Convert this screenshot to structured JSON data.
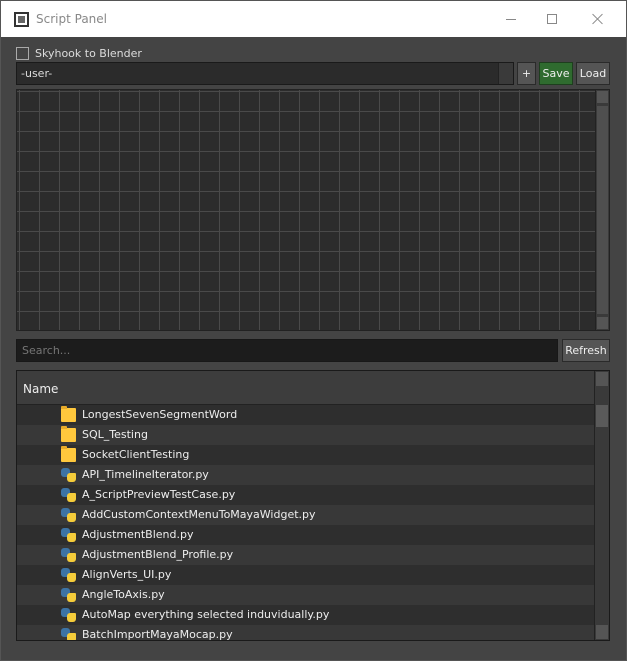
{
  "window": {
    "title": "Script Panel"
  },
  "options": {
    "skyhook_label": "Skyhook to Blender",
    "skyhook_checked": false
  },
  "toolbar": {
    "profile_value": "-user-",
    "plus_label": "+",
    "save_label": "Save",
    "load_label": "Load",
    "save_color": "#2f6b2f"
  },
  "search": {
    "placeholder": "Search...",
    "value": ""
  },
  "refresh_label": "Refresh",
  "tree": {
    "column_header": "Name",
    "items": [
      {
        "type": "folder",
        "icon": "folder-icon",
        "label": "LongestSevenSegmentWord"
      },
      {
        "type": "folder",
        "icon": "folder-icon",
        "label": "SQL_Testing"
      },
      {
        "type": "folder",
        "icon": "folder-icon",
        "label": "SocketClientTesting"
      },
      {
        "type": "file",
        "icon": "python-file-icon",
        "label": "API_TimelineIterator.py"
      },
      {
        "type": "file",
        "icon": "python-file-icon",
        "label": "A_ScriptPreviewTestCase.py"
      },
      {
        "type": "file",
        "icon": "python-file-icon",
        "label": "AddCustomContextMenuToMayaWidget.py"
      },
      {
        "type": "file",
        "icon": "python-file-icon",
        "label": "AdjustmentBlend.py"
      },
      {
        "type": "file",
        "icon": "python-file-icon",
        "label": "AdjustmentBlend_Profile.py"
      },
      {
        "type": "file",
        "icon": "python-file-icon",
        "label": "AlignVerts_UI.py"
      },
      {
        "type": "file",
        "icon": "python-file-icon",
        "label": "AngleToAxis.py"
      },
      {
        "type": "file",
        "icon": "python-file-icon",
        "label": "AutoMap everything selected induvidually.py"
      },
      {
        "type": "file",
        "icon": "python-file-icon",
        "label": "BatchImportMayaMocap.py"
      }
    ]
  }
}
